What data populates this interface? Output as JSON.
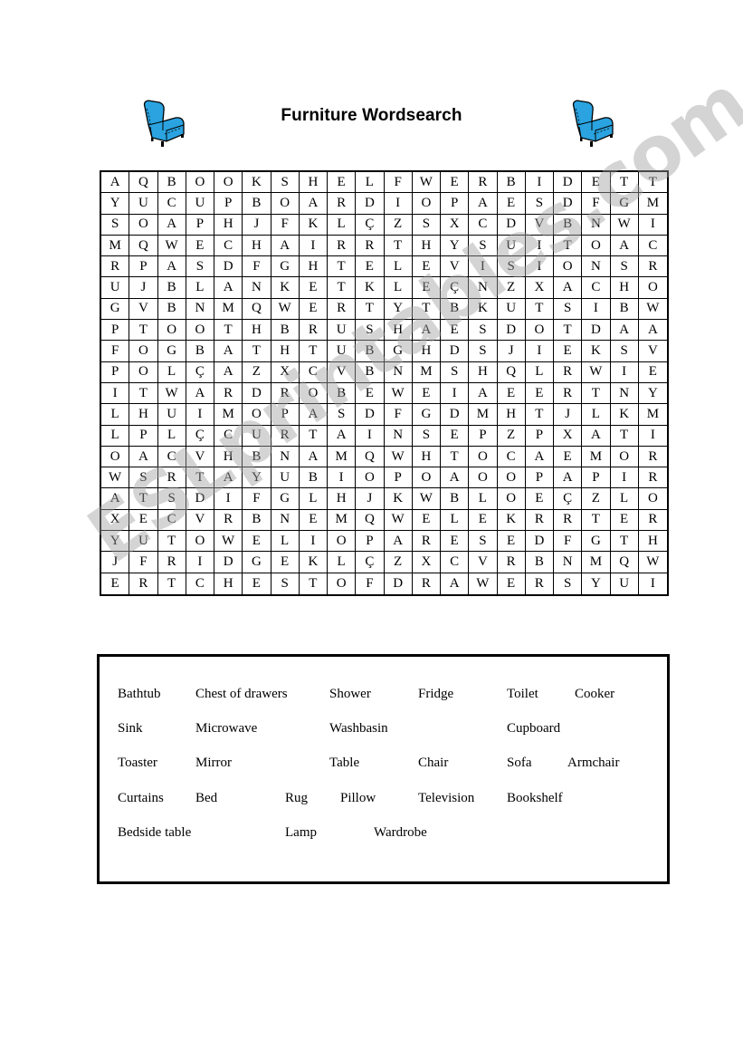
{
  "title": "Furniture Wordsearch",
  "icons": {
    "left": "armchair-icon",
    "right": "armchair-icon",
    "color": "#2aa3e0"
  },
  "grid": [
    [
      "A",
      "Q",
      "B",
      "O",
      "O",
      "K",
      "S",
      "H",
      "E",
      "L",
      "F",
      "W",
      "E",
      "R",
      "B",
      "I",
      "D",
      "E",
      "T",
      "T"
    ],
    [
      "Y",
      "U",
      "C",
      "U",
      "P",
      "B",
      "O",
      "A",
      "R",
      "D",
      "I",
      "O",
      "P",
      "A",
      "E",
      "S",
      "D",
      "F",
      "G",
      "M"
    ],
    [
      "S",
      "O",
      "A",
      "P",
      "H",
      "J",
      "F",
      "K",
      "L",
      "Ç",
      "Z",
      "S",
      "X",
      "C",
      "D",
      "V",
      "B",
      "N",
      "W",
      "I"
    ],
    [
      "M",
      "Q",
      "W",
      "E",
      "C",
      "H",
      "A",
      "I",
      "R",
      "R",
      "T",
      "H",
      "Y",
      "S",
      "U",
      "I",
      "T",
      "O",
      "A",
      "C"
    ],
    [
      "R",
      "P",
      "A",
      "S",
      "D",
      "F",
      "G",
      "H",
      "T",
      "E",
      "L",
      "E",
      "V",
      "I",
      "S",
      "I",
      "O",
      "N",
      "S",
      "R"
    ],
    [
      "U",
      "J",
      "B",
      "L",
      "A",
      "N",
      "K",
      "E",
      "T",
      "K",
      "L",
      "E",
      "Ç",
      "N",
      "Z",
      "X",
      "A",
      "C",
      "H",
      "O"
    ],
    [
      "G",
      "V",
      "B",
      "N",
      "M",
      "Q",
      "W",
      "E",
      "R",
      "T",
      "Y",
      "T",
      "B",
      "K",
      "U",
      "T",
      "S",
      "I",
      "B",
      "W"
    ],
    [
      "P",
      "T",
      "O",
      "O",
      "T",
      "H",
      "B",
      "R",
      "U",
      "S",
      "H",
      "A",
      "E",
      "S",
      "D",
      "O",
      "T",
      "D",
      "A",
      "A"
    ],
    [
      "F",
      "O",
      "G",
      "B",
      "A",
      "T",
      "H",
      "T",
      "U",
      "B",
      "G",
      "H",
      "D",
      "S",
      "J",
      "I",
      "E",
      "K",
      "S",
      "V"
    ],
    [
      "P",
      "O",
      "L",
      "Ç",
      "A",
      "Z",
      "X",
      "C",
      "V",
      "B",
      "N",
      "M",
      "S",
      "H",
      "Q",
      "L",
      "R",
      "W",
      "I",
      "E"
    ],
    [
      "I",
      "T",
      "W",
      "A",
      "R",
      "D",
      "R",
      "O",
      "B",
      "E",
      "W",
      "E",
      "I",
      "A",
      "E",
      "E",
      "R",
      "T",
      "N",
      "Y"
    ],
    [
      "L",
      "H",
      "U",
      "I",
      "M",
      "O",
      "P",
      "A",
      "S",
      "D",
      "F",
      "G",
      "D",
      "M",
      "H",
      "T",
      "J",
      "L",
      "K",
      "M"
    ],
    [
      "L",
      "P",
      "L",
      "Ç",
      "C",
      "U",
      "R",
      "T",
      "A",
      "I",
      "N",
      "S",
      "E",
      "P",
      "Z",
      "P",
      "X",
      "A",
      "T",
      "I"
    ],
    [
      "O",
      "A",
      "C",
      "V",
      "H",
      "B",
      "N",
      "A",
      "M",
      "Q",
      "W",
      "H",
      "T",
      "O",
      "C",
      "A",
      "E",
      "M",
      "O",
      "R"
    ],
    [
      "W",
      "S",
      "R",
      "T",
      "A",
      "Y",
      "U",
      "B",
      "I",
      "O",
      "P",
      "O",
      "A",
      "O",
      "O",
      "P",
      "A",
      "P",
      "I",
      "R"
    ],
    [
      "A",
      "T",
      "S",
      "D",
      "I",
      "F",
      "G",
      "L",
      "H",
      "J",
      "K",
      "W",
      "B",
      "L",
      "O",
      "E",
      "Ç",
      "Z",
      "L",
      "O"
    ],
    [
      "X",
      "E",
      "C",
      "V",
      "R",
      "B",
      "N",
      "E",
      "M",
      "Q",
      "W",
      "E",
      "L",
      "E",
      "K",
      "R",
      "R",
      "T",
      "E",
      "R"
    ],
    [
      "Y",
      "U",
      "T",
      "O",
      "W",
      "E",
      "L",
      "I",
      "O",
      "P",
      "A",
      "R",
      "E",
      "S",
      "E",
      "D",
      "F",
      "G",
      "T",
      "H"
    ],
    [
      "J",
      "F",
      "R",
      "I",
      "D",
      "G",
      "E",
      "K",
      "L",
      "Ç",
      "Z",
      "X",
      "C",
      "V",
      "R",
      "B",
      "N",
      "M",
      "Q",
      "W"
    ],
    [
      "E",
      "R",
      "T",
      "C",
      "H",
      "E",
      "S",
      "T",
      "O",
      "F",
      "D",
      "R",
      "A",
      "W",
      "E",
      "R",
      "S",
      "Y",
      "U",
      "I"
    ]
  ],
  "word_list": [
    [
      "Bathtub",
      "Chest of drawers",
      "Shower",
      "Fridge",
      "Toilet",
      "Cooker"
    ],
    [
      "Sink",
      "Microwave",
      "Washbasin",
      "Cupboard"
    ],
    [
      "Toaster",
      "Mirror",
      "Table",
      "Chair",
      "Sofa",
      "Armchair"
    ],
    [
      "Curtains",
      "Bed",
      "Rug",
      "Pillow",
      "Television",
      "Bookshelf"
    ],
    [
      "Bedside table",
      "Lamp",
      "Wardrobe"
    ]
  ],
  "watermark": "ESLprintables.com"
}
